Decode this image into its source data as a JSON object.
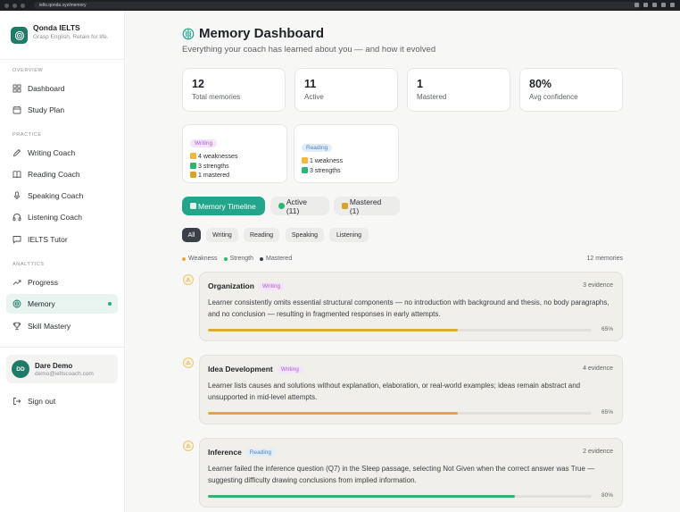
{
  "browser": {
    "url": "ielts.qonda.xyz/memory"
  },
  "brand": {
    "name": "Qonda IELTS",
    "tagline": "Grasp English. Retain for life."
  },
  "sidebar": {
    "sections": {
      "overview": "OVERVIEW",
      "practice": "PRACTICE",
      "analytics": "ANALYTICS"
    },
    "items": [
      {
        "label": "Dashboard",
        "icon": "grid-icon"
      },
      {
        "label": "Study Plan",
        "icon": "calendar-icon"
      },
      {
        "label": "Writing Coach",
        "icon": "pen-icon"
      },
      {
        "label": "Reading Coach",
        "icon": "book-icon"
      },
      {
        "label": "Speaking Coach",
        "icon": "mic-icon"
      },
      {
        "label": "Listening Coach",
        "icon": "headphones-icon"
      },
      {
        "label": "IELTS Tutor",
        "icon": "chat-icon"
      },
      {
        "label": "Progress",
        "icon": "trend-icon"
      },
      {
        "label": "Memory",
        "icon": "brain-icon",
        "active": true
      },
      {
        "label": "Skill Mastery",
        "icon": "trophy-icon"
      }
    ],
    "user": {
      "initials": "DD",
      "name": "Dare Demo",
      "email": "demo@ieltscoach.com"
    },
    "signout": "Sign out"
  },
  "header": {
    "title": "Memory Dashboard",
    "subtitle": "Everything your coach has learned about you — and how it evolved"
  },
  "stats": [
    {
      "value": "12",
      "label": "Total memories"
    },
    {
      "value": "11",
      "label": "Active"
    },
    {
      "value": "1",
      "label": "Mastered"
    },
    {
      "value": "80%",
      "label": "Avg confidence"
    }
  ],
  "skills": [
    {
      "tag": "Writing",
      "weak": "4 weaknesses",
      "strong": "3 strengths",
      "mastered": "1 mastered"
    },
    {
      "tag": "Reading",
      "weak": "1 weakness",
      "strong": "3 strengths"
    }
  ],
  "tabs": [
    {
      "label": "Memory Timeline",
      "active": true
    },
    {
      "label": "Active (11)"
    },
    {
      "label": "Mastered (1)"
    }
  ],
  "filters": [
    "All",
    "Writing",
    "Reading",
    "Speaking",
    "Listening"
  ],
  "legend": {
    "weakness": "Weakness",
    "strength": "Strength",
    "mastered": "Mastered",
    "count": "12 memories"
  },
  "colors": {
    "accent": "#23a58b",
    "weakness": "#e0a93a",
    "strength": "#2bb673",
    "mastered": "#3a4048"
  },
  "memories": [
    {
      "title": "Organization",
      "tag": "Writing",
      "evidence": "3 evidence",
      "text": "Learner consistently omits essential structural components — no introduction with background and thesis, no body paragraphs, and no conclusion — resulting in fragmented responses in early attempts.",
      "percent": "65%",
      "progress": 0.65,
      "kind": "weakness"
    },
    {
      "title": "Idea Development",
      "tag": "Writing",
      "evidence": "4 evidence",
      "text": "Learner lists causes and solutions without explanation, elaboration, or real-world examples; ideas remain abstract and unsupported in mid-level attempts.",
      "percent": "65%",
      "progress": 0.65,
      "kind": "weakness"
    },
    {
      "title": "Inference",
      "tag": "Reading",
      "evidence": "2 evidence",
      "text": "Learner failed the inference question (Q7) in the Sleep passage, selecting Not Given when the correct answer was True — suggesting difficulty drawing conclusions from implied information.",
      "percent": "80%",
      "progress": 0.8,
      "kind": "strength"
    }
  ]
}
